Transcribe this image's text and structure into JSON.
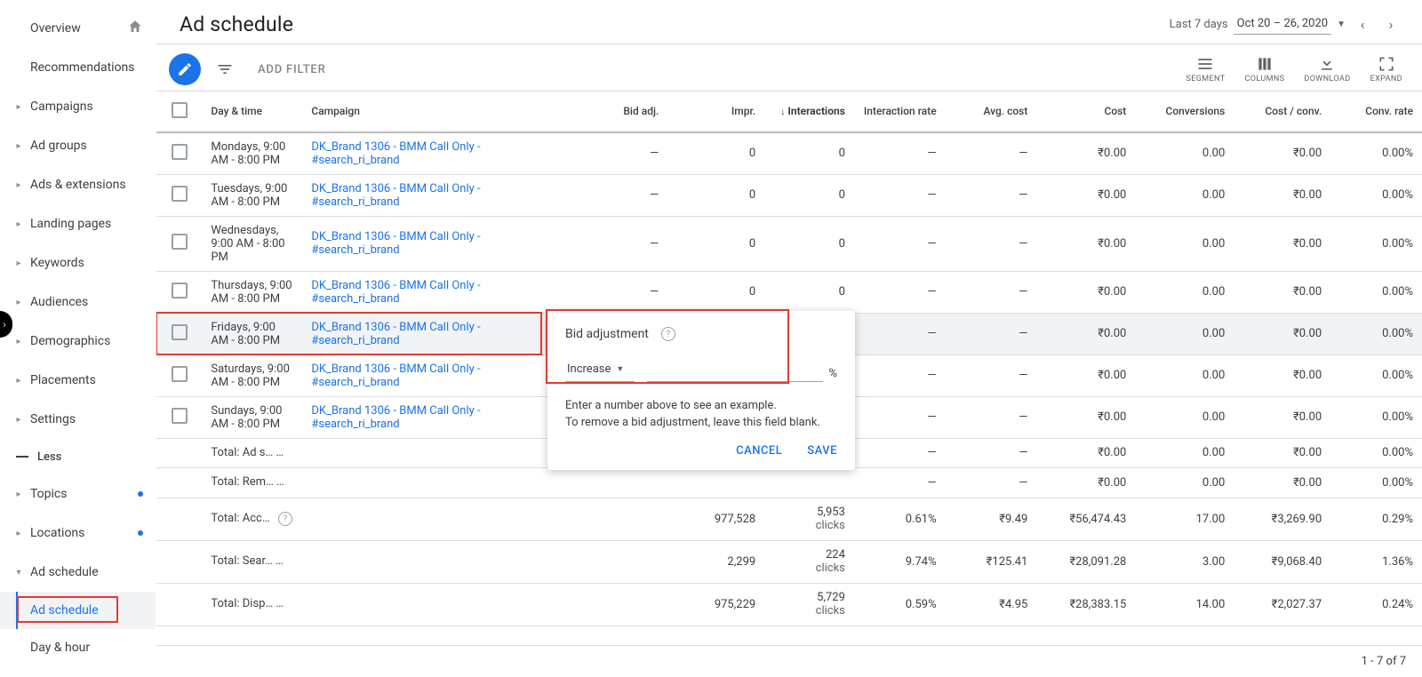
{
  "sidebar": {
    "items": [
      {
        "label": "Overview",
        "arrow": false,
        "home": true
      },
      {
        "label": "Recommendations",
        "arrow": false
      },
      {
        "label": "Campaigns",
        "arrow": true
      },
      {
        "label": "Ad groups",
        "arrow": true
      },
      {
        "label": "Ads & extensions",
        "arrow": true
      },
      {
        "label": "Landing pages",
        "arrow": true
      },
      {
        "label": "Keywords",
        "arrow": true
      },
      {
        "label": "Audiences",
        "arrow": true
      },
      {
        "label": "Demographics",
        "arrow": true
      },
      {
        "label": "Placements",
        "arrow": true
      },
      {
        "label": "Settings",
        "arrow": true
      }
    ],
    "less_label": "Less",
    "extra": [
      {
        "label": "Topics",
        "arrow": true,
        "dot": true
      },
      {
        "label": "Locations",
        "arrow": true,
        "dot": true
      },
      {
        "label": "Ad schedule",
        "arrow": true,
        "expanded": true
      }
    ],
    "sub": [
      {
        "label": "Ad schedule",
        "active": true
      },
      {
        "label": "Day & hour",
        "active": false
      }
    ]
  },
  "header": {
    "title": "Ad schedule",
    "date_prefix": "Last 7 days",
    "date_range": "Oct 20 – 26, 2020"
  },
  "toolbar": {
    "add_filter": "ADD FILTER",
    "segment": "SEGMENT",
    "columns": "COLUMNS",
    "download": "DOWNLOAD",
    "expand": "EXPAND"
  },
  "columns": {
    "day": "Day & time",
    "campaign": "Campaign",
    "bid": "Bid adj.",
    "impr": "Impr.",
    "interactions": "Interactions",
    "rate": "Interaction rate",
    "avg": "Avg. cost",
    "cost": "Cost",
    "conv": "Conversions",
    "cpc": "Cost / conv.",
    "crate": "Conv. rate"
  },
  "rows": [
    {
      "day": "Mondays, 9:00 AM - 8:00 PM",
      "campaign": "DK_Brand 1306 - BMM Call Only - #search_ri_brand",
      "bid": "—",
      "impr": "0",
      "inter": "0",
      "rate": "—",
      "avg": "—",
      "cost": "₹0.00",
      "conv": "0.00",
      "cpc": "₹0.00",
      "crate": "0.00%"
    },
    {
      "day": "Tuesdays, 9:00 AM - 8:00 PM",
      "campaign": "DK_Brand 1306 - BMM Call Only - #search_ri_brand",
      "bid": "—",
      "impr": "0",
      "inter": "0",
      "rate": "—",
      "avg": "—",
      "cost": "₹0.00",
      "conv": "0.00",
      "cpc": "₹0.00",
      "crate": "0.00%"
    },
    {
      "day": "Wednesdays, 9:00 AM - 8:00 PM",
      "campaign": "DK_Brand 1306 - BMM Call Only - #search_ri_brand",
      "bid": "—",
      "impr": "0",
      "inter": "0",
      "rate": "—",
      "avg": "—",
      "cost": "₹0.00",
      "conv": "0.00",
      "cpc": "₹0.00",
      "crate": "0.00%"
    },
    {
      "day": "Thursdays, 9:00 AM - 8:00 PM",
      "campaign": "DK_Brand 1306 - BMM Call Only - #search_ri_brand",
      "bid": "—",
      "impr": "0",
      "inter": "0",
      "rate": "—",
      "avg": "—",
      "cost": "₹0.00",
      "conv": "0.00",
      "cpc": "₹0.00",
      "crate": "0.00%"
    },
    {
      "day": "Fridays, 9:00 AM - 8:00 PM",
      "campaign": "DK_Brand 1306 - BMM Call Only - #search_ri_brand",
      "bid": "",
      "impr": "",
      "inter": "",
      "rate": "—",
      "avg": "—",
      "cost": "₹0.00",
      "conv": "0.00",
      "cpc": "₹0.00",
      "crate": "0.00%",
      "highlight": true
    },
    {
      "day": "Saturdays, 9:00 AM - 8:00 PM",
      "campaign": "DK_Brand 1306 - BMM Call Only - #search_ri_brand",
      "bid": "",
      "impr": "",
      "inter": "",
      "rate": "—",
      "avg": "—",
      "cost": "₹0.00",
      "conv": "0.00",
      "cpc": "₹0.00",
      "crate": "0.00%"
    },
    {
      "day": "Sundays, 9:00 AM - 8:00 PM",
      "campaign": "DK_Brand 1306 - BMM Call Only - #search_ri_brand",
      "bid": "",
      "impr": "",
      "inter": "",
      "rate": "—",
      "avg": "—",
      "cost": "₹0.00",
      "conv": "0.00",
      "cpc": "₹0.00",
      "crate": "0.00%"
    }
  ],
  "totals": [
    {
      "label": "Total: Ad s…",
      "bid": "—",
      "impr": "",
      "inter": "",
      "rate": "—",
      "avg": "—",
      "cost": "₹0.00",
      "conv": "0.00",
      "cpc": "₹0.00",
      "crate": "0.00%"
    },
    {
      "label": "Total: Rem…",
      "bid": "",
      "impr": "",
      "inter": "",
      "rate": "—",
      "avg": "—",
      "cost": "₹0.00",
      "conv": "0.00",
      "cpc": "₹0.00",
      "crate": "0.00%"
    },
    {
      "label": "Total: Acc…",
      "bid": "",
      "impr": "977,528",
      "inter": "5,953",
      "inter_sub": "clicks",
      "rate": "0.61%",
      "avg": "₹9.49",
      "cost": "₹56,474.43",
      "conv": "17.00",
      "cpc": "₹3,269.90",
      "crate": "0.29%"
    },
    {
      "label": "Total: Sear…",
      "bid": "",
      "impr": "2,299",
      "inter": "224",
      "inter_sub": "clicks",
      "rate": "9.74%",
      "avg": "₹125.41",
      "cost": "₹28,091.28",
      "conv": "3.00",
      "cpc": "₹9,068.40",
      "crate": "1.36%"
    },
    {
      "label": "Total: Disp…",
      "bid": "",
      "impr": "975,229",
      "inter": "5,729",
      "inter_sub": "clicks",
      "rate": "0.59%",
      "avg": "₹4.95",
      "cost": "₹28,383.15",
      "conv": "14.00",
      "cpc": "₹2,027.37",
      "crate": "0.24%"
    }
  ],
  "popover": {
    "title": "Bid adjustment",
    "mode": "Increase",
    "unit": "%",
    "help1": "Enter a number above to see an example.",
    "help2": "To remove a bid adjustment, leave this field blank.",
    "cancel": "CANCEL",
    "save": "SAVE"
  },
  "footer": {
    "pagination": "1 - 7 of 7"
  }
}
